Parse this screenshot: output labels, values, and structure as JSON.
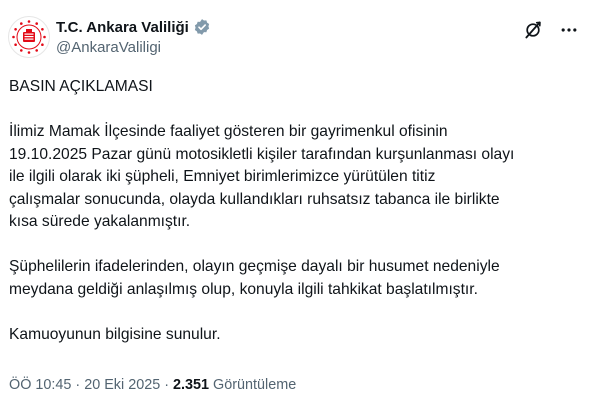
{
  "author": {
    "display_name": "T.C. Ankara Valiliği",
    "handle": "@AnkaraValiligi",
    "verified_badge": "government-verified-badge",
    "badge_color": "#829aab"
  },
  "header_actions": {
    "grok_icon": "grok-icon",
    "more_icon": "more-options-icon"
  },
  "tweet": {
    "heading": "BASIN AÇIKLAMASI",
    "paragraph1": [
      "İlimiz Mamak İlçesinde faaliyet gösteren bir gayrimenkul ofisinin",
      "19.10.2025 Pazar günü motosikletli kişiler tarafından kurşunlanması olayı",
      "ile ilgili olarak iki şüpheli, Emniyet birimlerimizce yürütülen titiz",
      "çalışmalar sonucunda, olayda kullandıkları ruhsatsız tabanca ile birlikte",
      "kısa sürede yakalanmıştır."
    ],
    "paragraph2": [
      "Şüphelilerin ifadelerinden, olayın geçmişe dayalı bir husumet nedeniyle",
      "meydana geldiği anlaşılmış olup, konuyla ilgili tahkikat başlatılmıştır."
    ],
    "paragraph3": "Kamuoyunun bilgisine sunulur."
  },
  "meta": {
    "time": "ÖÖ 10:45",
    "separator": "·",
    "date": "20 Eki 2025",
    "views_count": "2.351",
    "views_label": "Görüntüleme"
  },
  "colors": {
    "text_primary": "#0f1419",
    "text_secondary": "#536471",
    "emblem_red": "#e30a17"
  }
}
